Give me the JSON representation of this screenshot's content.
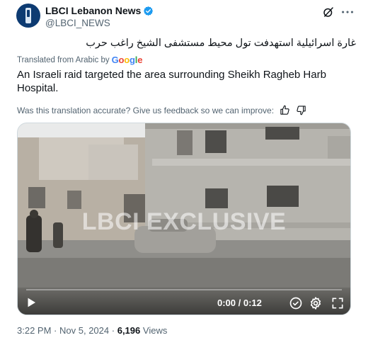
{
  "author": {
    "display_name": "LBCI Lebanon News",
    "handle": "@LBCI_NEWS",
    "verified": true
  },
  "icons": {
    "avatar": "lbci-logo",
    "verified": "verified-badge-icon",
    "grok": "grok-icon",
    "more": "more-icon"
  },
  "tweet": {
    "original_text": "غارة اسرائيلية استهدفت تول محيط مستشفى الشيخ راغب حرب",
    "translated_from": "Translated from Arabic by",
    "translation_provider": "Google",
    "translation": "An Israeli raid targeted the area surrounding Sheikh Ragheb Harb Hospital.",
    "feedback_prompt": "Was this translation accurate? Give us feedback so we can improve:"
  },
  "video": {
    "watermark": "LBCI EXCLUSIVE",
    "time_display": "0:00 / 0:12",
    "progress_fraction": 0
  },
  "meta": {
    "time": "3:22 PM",
    "separator": "·",
    "date": "Nov 5, 2024",
    "views_count": "6,196",
    "views_label": "Views"
  },
  "colors": {
    "text_primary": "#0f1419",
    "text_secondary": "#536471",
    "verified_blue": "#1d9bf0"
  }
}
